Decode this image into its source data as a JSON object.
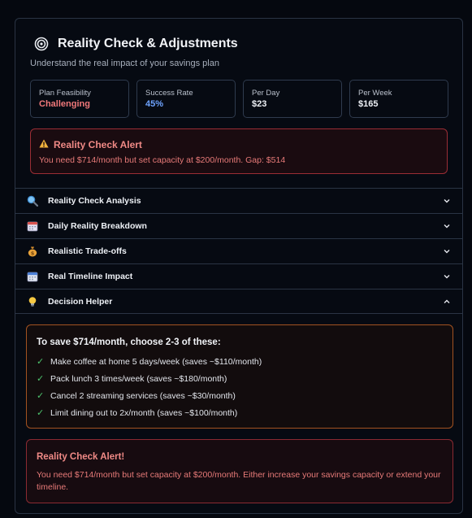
{
  "header": {
    "icon": "target-icon",
    "title": "Reality Check & Adjustments",
    "subtitle": "Understand the real impact of your savings plan"
  },
  "stats": [
    {
      "label": "Plan Feasibility",
      "value": "Challenging",
      "color": "#f0787a"
    },
    {
      "label": "Success Rate",
      "value": "45%",
      "color": "#6ea3ff"
    },
    {
      "label": "Per Day",
      "value": "$23",
      "color": "#eef1f6"
    },
    {
      "label": "Per Week",
      "value": "$165",
      "color": "#eef1f6"
    }
  ],
  "alert": {
    "icon": "warning-icon",
    "title": "Reality Check Alert",
    "text": "You need $714/month but set capacity at $200/month. Gap: $514"
  },
  "accordion": [
    {
      "icon": "magnifier-icon",
      "label": "Reality Check Analysis",
      "expanded": false
    },
    {
      "icon": "calendar-icon",
      "label": "Daily Reality Breakdown",
      "expanded": false
    },
    {
      "icon": "money-bag-icon",
      "label": "Realistic Trade-offs",
      "expanded": false
    },
    {
      "icon": "calendar-icon",
      "label": "Real Timeline Impact",
      "expanded": false
    },
    {
      "icon": "lightbulb-icon",
      "label": "Decision Helper",
      "expanded": true
    }
  ],
  "decision_helper": {
    "title": "To save $714/month, choose 2-3 of these:",
    "items": [
      "Make coffee at home 5 days/week (saves ~$110/month)",
      "Pack lunch 3 times/week (saves ~$180/month)",
      "Cancel 2 streaming services (saves ~$30/month)",
      "Limit dining out to 2x/month (saves ~$100/month)"
    ]
  },
  "alert2": {
    "title": "Reality Check Alert!",
    "text": "You need $714/month but set capacity at $200/month. Either increase your savings capacity or extend your timeline."
  },
  "colors": {
    "background": "#05080f",
    "border": "#2a3444",
    "danger": "#f0787a",
    "accent_blue": "#6ea3ff",
    "helper_border": "#a25221",
    "check_green": "#4ec46e"
  }
}
